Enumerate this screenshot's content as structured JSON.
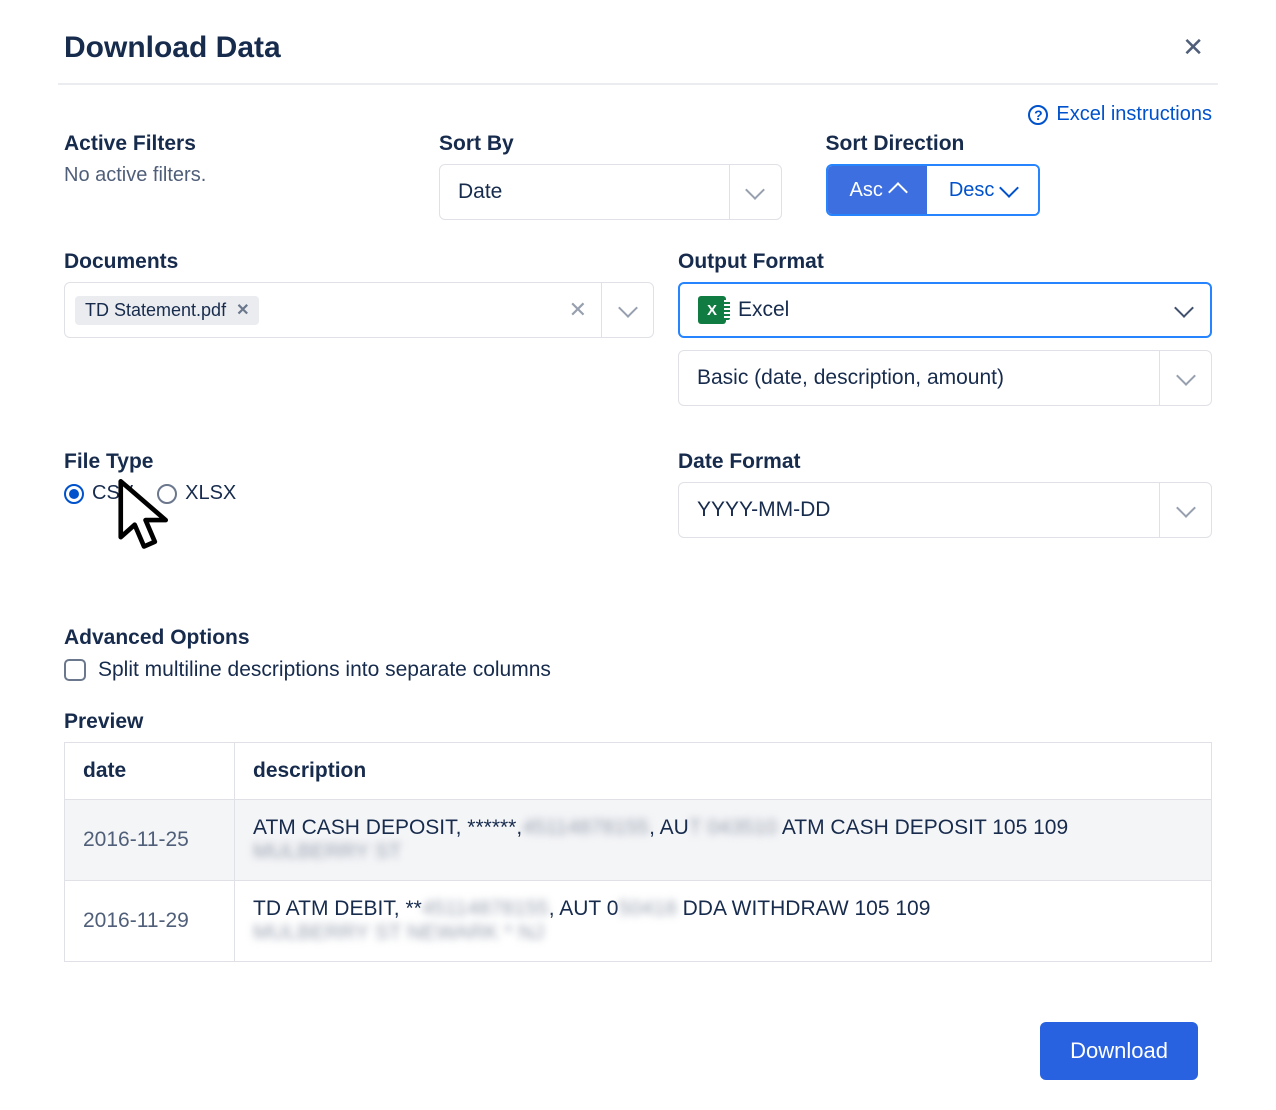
{
  "modal": {
    "title": "Download Data",
    "help_link": "Excel instructions"
  },
  "filters": {
    "label": "Active Filters",
    "value": "No active filters."
  },
  "sort_by": {
    "label": "Sort By",
    "value": "Date"
  },
  "sort_dir": {
    "label": "Sort Direction",
    "asc": "Asc",
    "desc": "Desc"
  },
  "documents": {
    "label": "Documents",
    "tag": "TD Statement.pdf"
  },
  "output": {
    "label": "Output Format",
    "format": "Excel",
    "template": "Basic (date, description, amount)"
  },
  "file_type": {
    "label": "File Type",
    "csv": "CSV",
    "xlsx": "XLSX"
  },
  "date_format": {
    "label": "Date Format",
    "value": "YYYY-MM-DD"
  },
  "advanced": {
    "label": "Advanced Options",
    "split": "Split multiline descriptions into separate columns"
  },
  "preview": {
    "label": "Preview",
    "headers": {
      "date": "date",
      "description": "description"
    },
    "rows": [
      {
        "date": "2016-11-25",
        "p1": "ATM CASH DEPOSIT, ******,",
        "b1": "45114878155",
        "p2": ", AU",
        "b2": "T 043510",
        "p3": " ATM CASH DEPOSIT 105 109 ",
        "b3": "MULBERRY ST"
      },
      {
        "date": "2016-11-29",
        "p1": "TD ATM DEBIT, **",
        "b1": "45114878155",
        "p2": ", AUT 0",
        "b2": "50418",
        "p3": " DDA WITHDRAW 105 109 ",
        "b3": "MULBERRY ST NEWARK * NJ"
      }
    ]
  },
  "footer": {
    "download": "Download"
  }
}
